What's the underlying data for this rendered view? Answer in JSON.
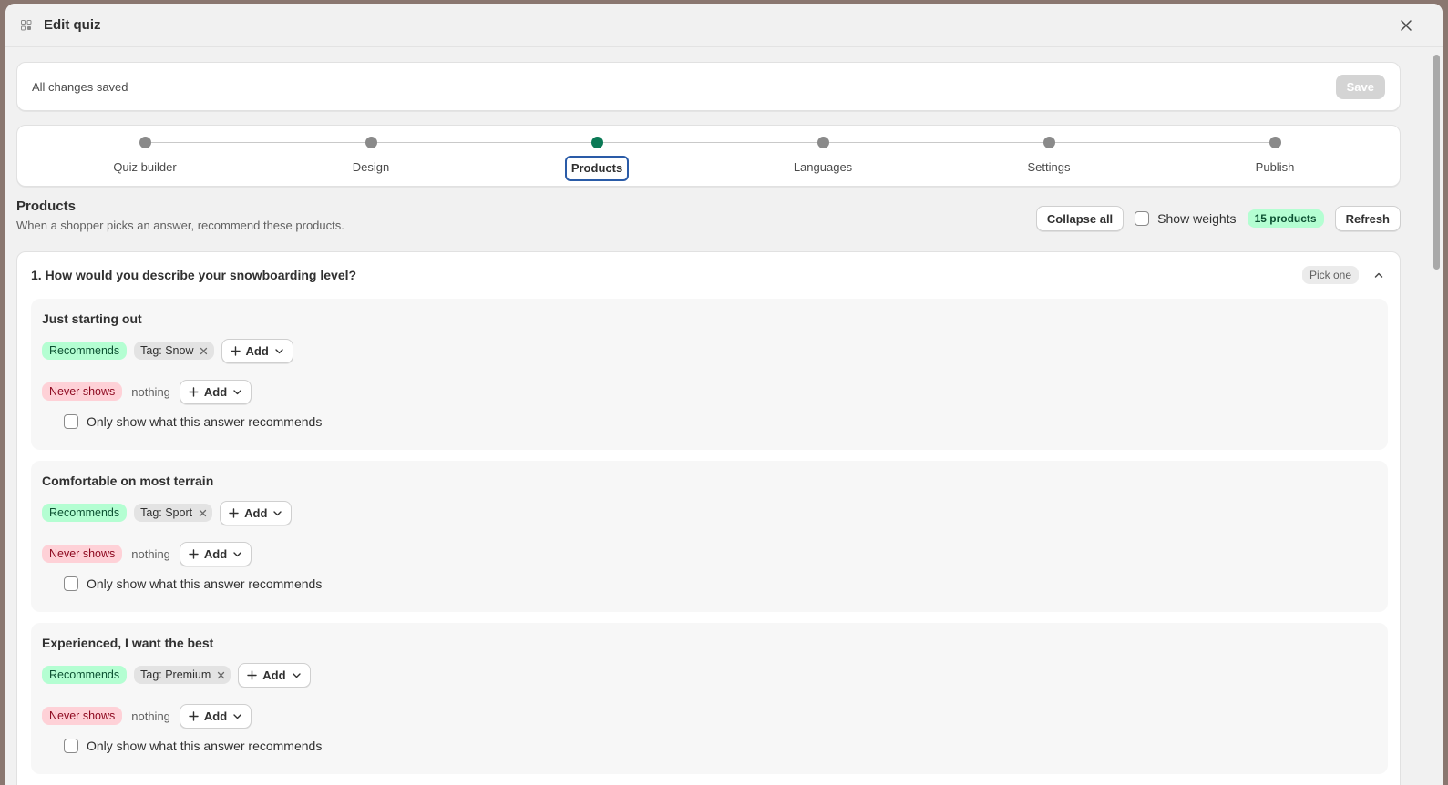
{
  "modal": {
    "title": "Edit quiz"
  },
  "save_bar": {
    "status": "All changes saved",
    "save_label": "Save"
  },
  "stepper": {
    "steps": [
      {
        "label": "Quiz builder",
        "active": false
      },
      {
        "label": "Design",
        "active": false
      },
      {
        "label": "Products",
        "active": true
      },
      {
        "label": "Languages",
        "active": false
      },
      {
        "label": "Settings",
        "active": false
      },
      {
        "label": "Publish",
        "active": false
      }
    ]
  },
  "section": {
    "title": "Products",
    "subtitle": "When a shopper picks an answer, recommend these products.",
    "collapse_label": "Collapse all",
    "show_weights_label": "Show weights",
    "products_count": "15 products",
    "refresh_label": "Refresh"
  },
  "question": {
    "title": "1. How would you describe your snowboarding level?",
    "mode": "Pick one",
    "answers": [
      {
        "title": "Just starting out",
        "recommends_label": "Recommends",
        "tag": "Tag: Snow",
        "add_label": "Add",
        "never_label": "Never shows",
        "nothing_label": "nothing",
        "only_label": "Only show what this answer recommends"
      },
      {
        "title": "Comfortable on most terrain",
        "recommends_label": "Recommends",
        "tag": "Tag: Sport",
        "add_label": "Add",
        "never_label": "Never shows",
        "nothing_label": "nothing",
        "only_label": "Only show what this answer recommends"
      },
      {
        "title": "Experienced, I want the best",
        "recommends_label": "Recommends",
        "tag": "Tag: Premium",
        "add_label": "Add",
        "never_label": "Never shows",
        "nothing_label": "nothing",
        "only_label": "Only show what this answer recommends"
      }
    ]
  },
  "colors": {
    "accent_active_step": "#0b7a56",
    "recommends_bg": "#b4fed2",
    "never_bg": "#fed1d7",
    "focus_outline": "#2a5ba7"
  }
}
